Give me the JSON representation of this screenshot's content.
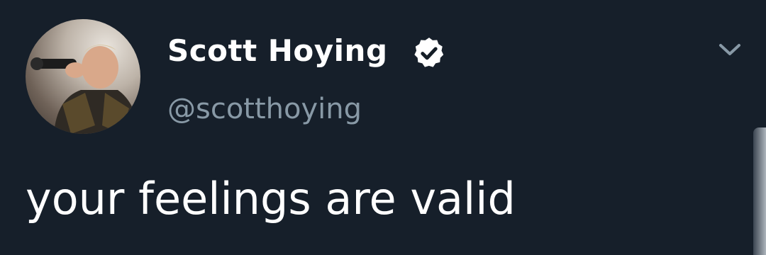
{
  "tweet": {
    "author": {
      "display_name": "Scott Hoying",
      "handle": "@scotthoying",
      "verified": true,
      "verified_icon": "verified-badge-icon",
      "avatar_icon": "avatar-photo"
    },
    "text": "your feelings are valid",
    "menu_icon": "chevron-down-icon"
  },
  "colors": {
    "background": "#141d26",
    "text_primary": "#ffffff",
    "text_secondary": "#8899a6"
  }
}
